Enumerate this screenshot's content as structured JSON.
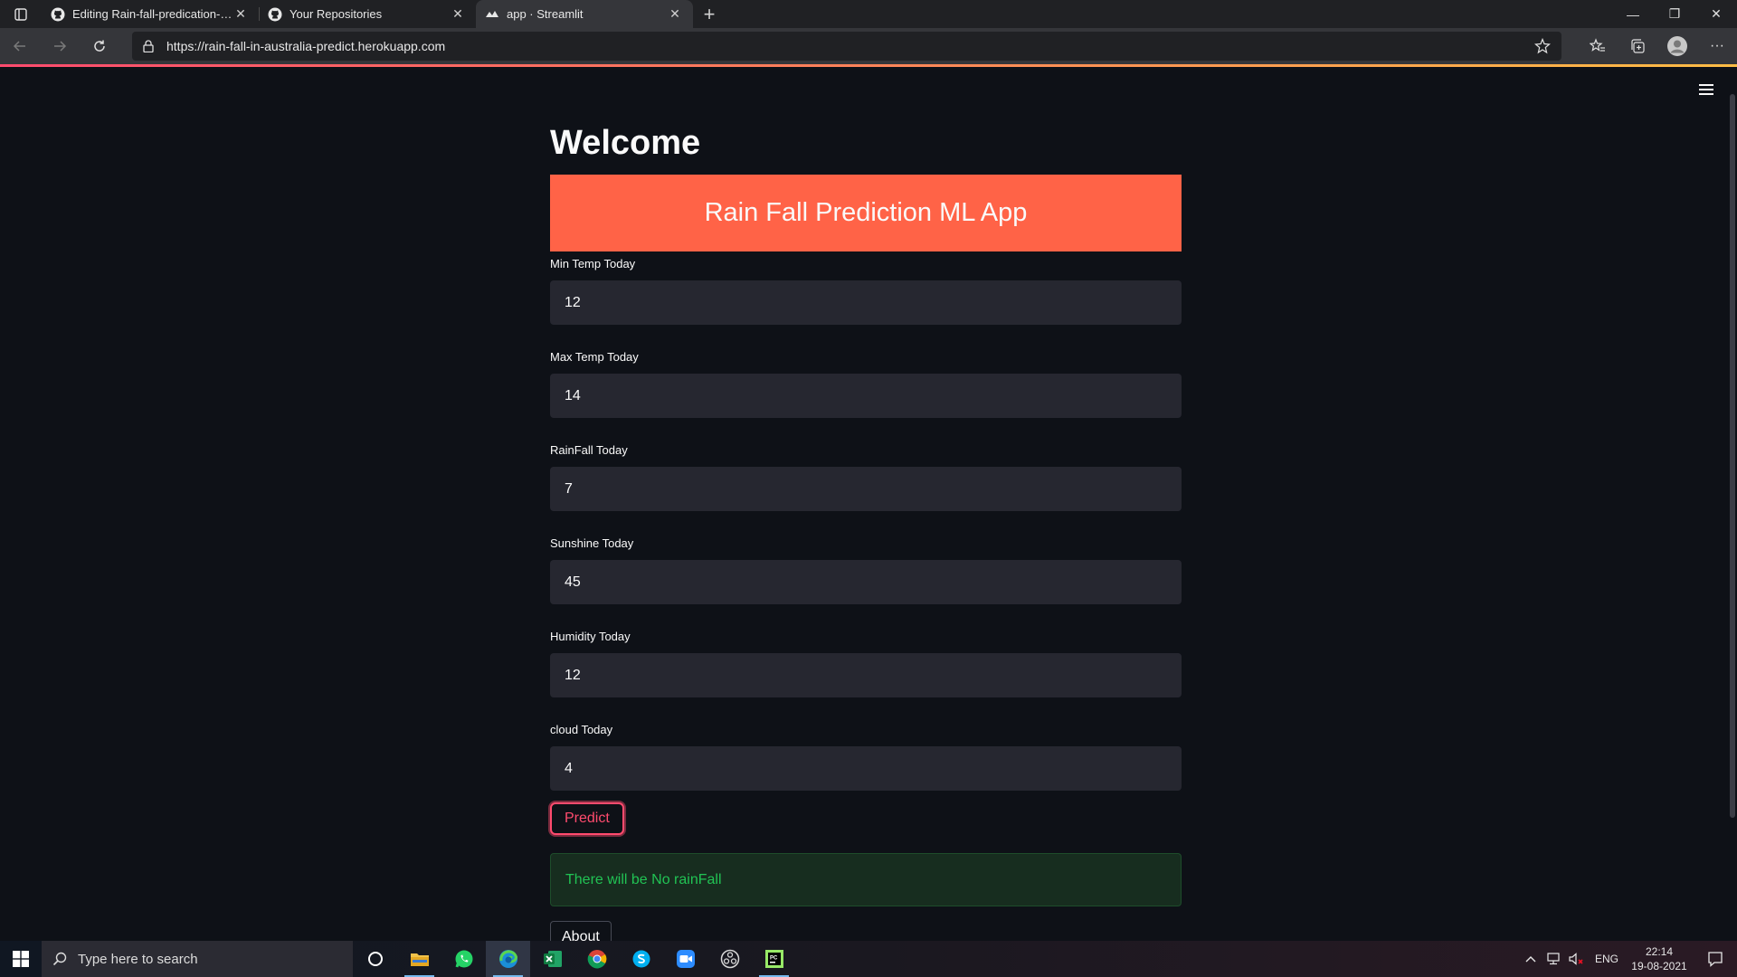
{
  "browser": {
    "tabs": [
      {
        "title": "Editing Rain-fall-predication-in-/",
        "icon": "github-icon",
        "active": false
      },
      {
        "title": "Your Repositories",
        "icon": "github-icon",
        "active": false
      },
      {
        "title": "app · Streamlit",
        "icon": "streamlit-icon",
        "active": true
      }
    ],
    "url": "https://rain-fall-in-australia-predict.herokuapp.com"
  },
  "app": {
    "heading": "Welcome",
    "banner": "Rain Fall Prediction ML App",
    "banner_color": "#ff6347",
    "fields": [
      {
        "label": "Min Temp Today",
        "value": "12"
      },
      {
        "label": "Max Temp Today",
        "value": "14"
      },
      {
        "label": "RainFall Today",
        "value": "7"
      },
      {
        "label": "Sunshine Today",
        "value": "45"
      },
      {
        "label": "Humidity Today",
        "value": "12"
      },
      {
        "label": "cloud Today",
        "value": "4"
      }
    ],
    "predict_label": "Predict",
    "result": "There will be No rainFall",
    "about_label": "About"
  },
  "taskbar": {
    "search_placeholder": "Type here to search",
    "apps": [
      "cortana-icon",
      "file-explorer-icon",
      "whatsapp-icon",
      "edge-icon",
      "excel-icon",
      "chrome-icon",
      "skype-icon",
      "zoom-icon",
      "obs-icon",
      "pycharm-icon"
    ],
    "language": "ENG",
    "time": "22:14",
    "date": "19-08-2021"
  },
  "colors": {
    "accent": "#ff4b6e",
    "success": "#21c354",
    "background": "#0e1117",
    "input": "#262730"
  }
}
